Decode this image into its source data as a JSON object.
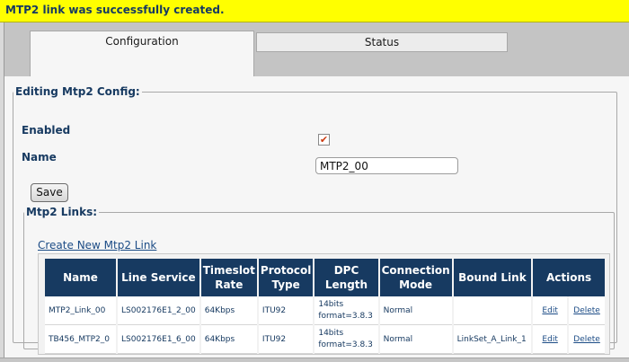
{
  "alert": {
    "message": "MTP2 link was successfully created."
  },
  "tabs": [
    {
      "label": "Configuration",
      "active": true
    },
    {
      "label": "Status",
      "active": false
    }
  ],
  "form": {
    "legend": "Editing Mtp2 Config:",
    "enabled_label": "Enabled",
    "enabled_checked": true,
    "name_label": "Name",
    "name_value": "MTP2_00",
    "save_label": "Save"
  },
  "links": {
    "legend": "Mtp2 Links:",
    "create_label": "Create New Mtp2 Link",
    "headers": {
      "name": "Name",
      "line_service": "Line Service",
      "timeslot_rate": "Timeslot Rate",
      "protocol_type": "Protocol Type",
      "dpc_length": "DPC Length",
      "connection_mode": "Connection Mode",
      "bound_link": "Bound Link",
      "actions": "Actions"
    },
    "rows": [
      {
        "name": "MTP2_Link_00",
        "line_service": "LS002176E1_2_00",
        "timeslot_rate": "64Kbps",
        "protocol_type": "ITU92",
        "dpc_line1": "14bits",
        "dpc_line2": "format=3.8.3",
        "connection_mode": "Normal",
        "bound_link": "",
        "edit": "Edit",
        "delete": "Delete"
      },
      {
        "name": "TB456_MTP2_0",
        "line_service": "LS002176E1_6_00",
        "timeslot_rate": "64Kbps",
        "protocol_type": "ITU92",
        "dpc_line1": "14bits",
        "dpc_line2": "format=3.8.3",
        "connection_mode": "Normal",
        "bound_link": "LinkSet_A_Link_1",
        "edit": "Edit",
        "delete": "Delete"
      }
    ]
  },
  "colors": {
    "alert_bg": "#ffff00",
    "header_bg": "#173a61",
    "label_text": "#173a61",
    "link_text": "#1c4c86"
  },
  "icons": {
    "checkbox": "checkmark-icon"
  }
}
